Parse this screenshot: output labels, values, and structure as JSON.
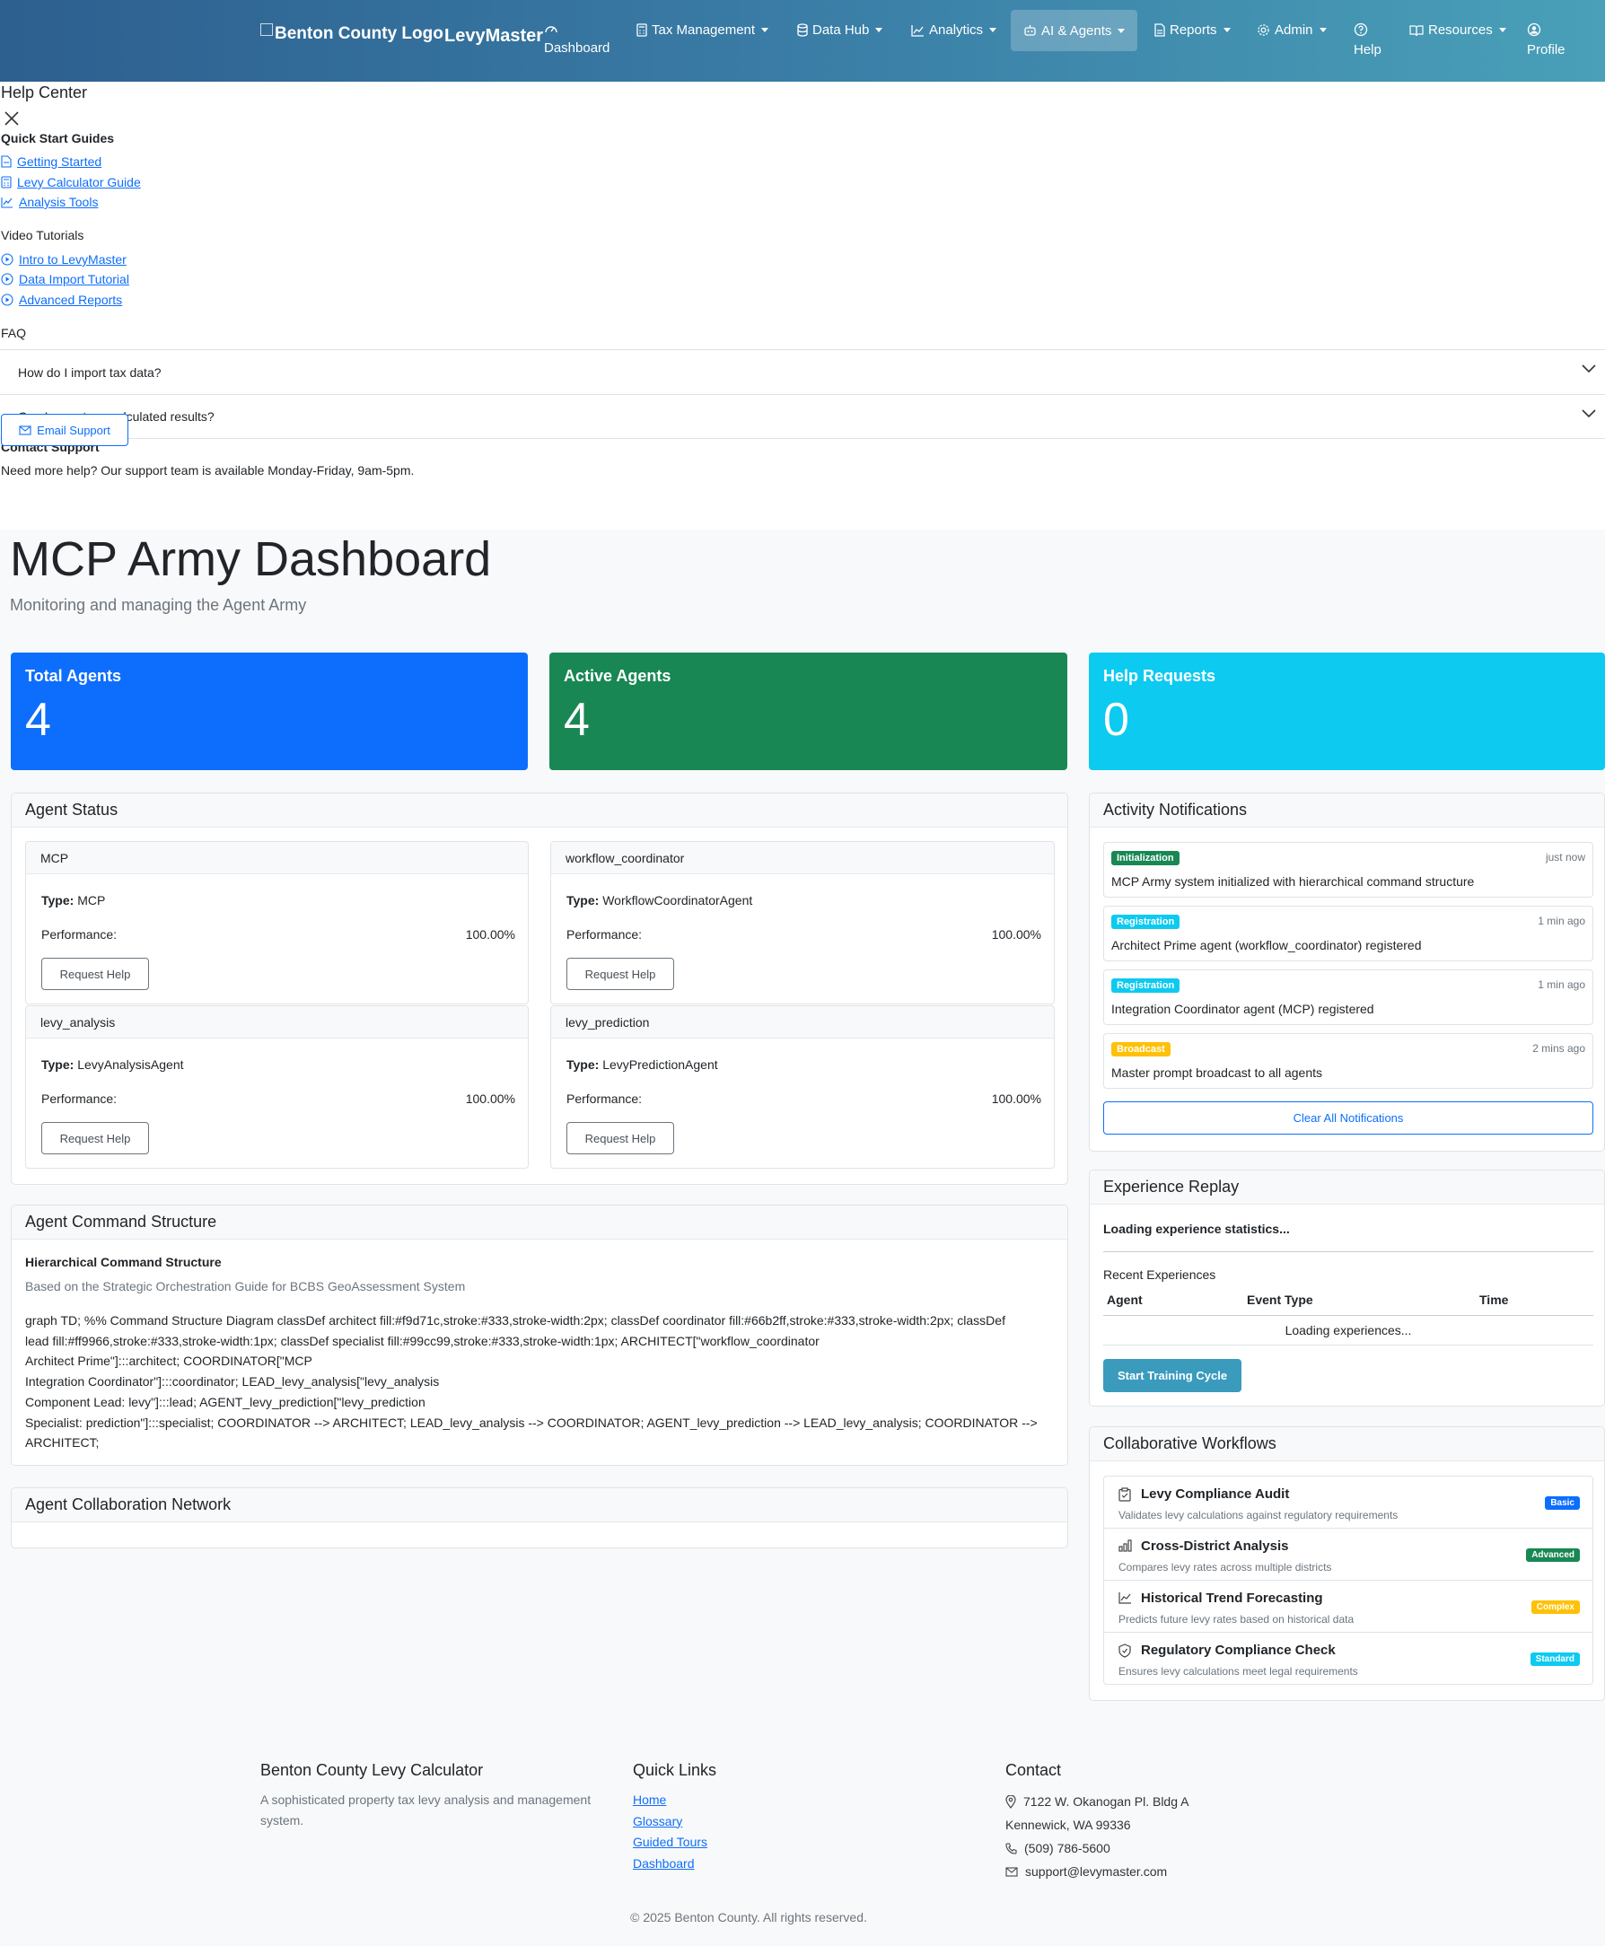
{
  "nav": {
    "logo_alt": "Benton County Logo",
    "brand": "LevyMaster",
    "dashboard": "Dashboard",
    "tax_management": "Tax Management",
    "data_hub": "Data Hub",
    "analytics": "Analytics",
    "ai_agents": "AI & Agents",
    "reports": "Reports",
    "admin": "Admin",
    "help": "Help",
    "resources": "Resources",
    "profile": "Profile"
  },
  "help_center": {
    "title": "Help Center",
    "quick_start_title": "Quick Start Guides",
    "quick_start": [
      "Getting Started",
      "Levy Calculator Guide",
      "Analysis Tools"
    ],
    "video_title": "Video Tutorials",
    "videos": [
      "Intro to LevyMaster",
      "Data Import Tutorial",
      "Advanced Reports"
    ],
    "faq_title": "FAQ",
    "faq": [
      "How do I import tax data?",
      "Can I export my calculated results?"
    ],
    "contact_title": "Contact Support",
    "contact_text": "Need more help? Our support team is available Monday-Friday, 9am-5pm.",
    "email_button": "Email Support"
  },
  "dashboard": {
    "title": "MCP Army Dashboard",
    "subtitle": "Monitoring and managing the Agent Army"
  },
  "stats": {
    "total_label": "Total Agents",
    "total_value": "4",
    "active_label": "Active Agents",
    "active_value": "4",
    "help_label": "Help Requests",
    "help_value": "0",
    "colors": {
      "total": "#0d6efd",
      "active": "#198754",
      "help": "#0dcaf0"
    }
  },
  "agent_status": {
    "title": "Agent Status",
    "type_label": "Type:",
    "perf_label": "Performance:",
    "button": "Request Help",
    "agents": [
      {
        "name": "MCP",
        "type": "MCP",
        "performance": "100.00%"
      },
      {
        "name": "workflow_coordinator",
        "type": "WorkflowCoordinatorAgent",
        "performance": "100.00%"
      },
      {
        "name": "levy_analysis",
        "type": "LevyAnalysisAgent",
        "performance": "100.00%"
      },
      {
        "name": "levy_prediction",
        "type": "LevyPredictionAgent",
        "performance": "100.00%"
      }
    ]
  },
  "command_structure": {
    "title": "Agent Command Structure",
    "subtitle": "Hierarchical Command Structure",
    "based_on": "Based on the Strategic Orchestration Guide for BCBS GeoAssessment System",
    "lines": [
      "graph TD; %% Command Structure Diagram classDef architect fill:#f9d71c,stroke:#333,stroke-width:2px; classDef coordinator fill:#66b2ff,stroke:#333,stroke-width:2px; classDef",
      "lead fill:#ff9966,stroke:#333,stroke-width:1px; classDef specialist fill:#99cc99,stroke:#333,stroke-width:1px; ARCHITECT[\"workflow_coordinator",
      "Architect Prime\"]:::architect; COORDINATOR[\"MCP",
      "Integration Coordinator\"]:::coordinator; LEAD_levy_analysis[\"levy_analysis",
      "Component Lead: levy\"]:::lead; AGENT_levy_prediction[\"levy_prediction",
      "Specialist: prediction\"]:::specialist; COORDINATOR --> ARCHITECT; LEAD_levy_analysis --> COORDINATOR; AGENT_levy_prediction --> LEAD_levy_analysis; COORDINATOR -->",
      "ARCHITECT;"
    ]
  },
  "collab_network": {
    "title": "Agent Collaboration Network"
  },
  "notifications": {
    "title": "Activity Notifications",
    "items": [
      {
        "badge": "Initialization",
        "color": "#198754",
        "time": "just now",
        "message": "MCP Army system initialized with hierarchical command structure"
      },
      {
        "badge": "Registration",
        "color": "#0dcaf0",
        "time": "1 min ago",
        "message": "Architect Prime agent (workflow_coordinator) registered"
      },
      {
        "badge": "Registration",
        "color": "#0dcaf0",
        "time": "1 min ago",
        "message": "Integration Coordinator agent (MCP) registered"
      },
      {
        "badge": "Broadcast",
        "color": "#ffc107",
        "time": "2 mins ago",
        "message": "Master prompt broadcast to all agents"
      }
    ],
    "clear_button": "Clear All Notifications"
  },
  "experience": {
    "title": "Experience Replay",
    "loading_stats": "Loading experience statistics...",
    "recent_title": "Recent Experiences",
    "columns": [
      "Agent",
      "Event Type",
      "Time"
    ],
    "loading_rows": "Loading experiences...",
    "button": "Start Training Cycle"
  },
  "workflows": {
    "title": "Collaborative Workflows",
    "items": [
      {
        "name": "Levy Compliance Audit",
        "desc": "Validates levy calculations against regulatory requirements",
        "badge": "Basic",
        "color": "#0d6efd",
        "icon": "clipboard-icon"
      },
      {
        "name": "Cross-District Analysis",
        "desc": "Compares levy rates across multiple districts",
        "badge": "Advanced",
        "color": "#198754",
        "icon": "bar-chart-icon"
      },
      {
        "name": "Historical Trend Forecasting",
        "desc": "Predicts future levy rates based on historical data",
        "badge": "Complex",
        "color": "#ffc107",
        "icon": "line-chart-icon"
      },
      {
        "name": "Regulatory Compliance Check",
        "desc": "Ensures levy calculations meet legal requirements",
        "badge": "Standard",
        "color": "#0dcaf0",
        "icon": "shield-icon"
      }
    ]
  },
  "footer": {
    "about_title": "Benton County Levy Calculator",
    "about_text_1": "A sophisticated property tax levy analysis and management",
    "about_text_2": "system.",
    "links_title": "Quick Links",
    "links": [
      "Home",
      "Glossary",
      "Guided Tours",
      "Dashboard"
    ],
    "contact_title": "Contact",
    "address_1": "7122 W. Okanogan Pl. Bldg A",
    "address_2": "Kennewick, WA 99336",
    "phone": "(509) 786-5600",
    "email": "support@levymaster.com",
    "copyright": "© 2025 Benton County. All rights reserved."
  }
}
